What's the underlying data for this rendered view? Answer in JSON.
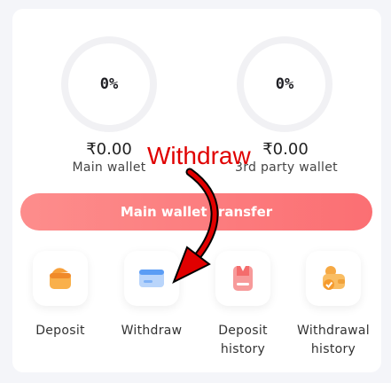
{
  "wallets": [
    {
      "percent": "0%",
      "amount": "₹0.00",
      "label": "Main wallet"
    },
    {
      "percent": "0%",
      "amount": "₹0.00",
      "label": "3rd party wallet"
    }
  ],
  "transfer_button": {
    "label": "Main wallet transfer"
  },
  "actions": [
    {
      "line1": "Deposit",
      "line2": "",
      "icon": "wallet-icon"
    },
    {
      "line1": "Withdraw",
      "line2": "",
      "icon": "card-icon"
    },
    {
      "line1": "Deposit",
      "line2": "history",
      "icon": "receipt-icon"
    },
    {
      "line1": "Withdrawal",
      "line2": "history",
      "icon": "coin-wallet-icon"
    }
  ],
  "annotation": {
    "text": "Withdraw",
    "color": "#e00000"
  },
  "colors": {
    "accent_start": "#fd8d8c",
    "accent_end": "#fb6f73"
  }
}
